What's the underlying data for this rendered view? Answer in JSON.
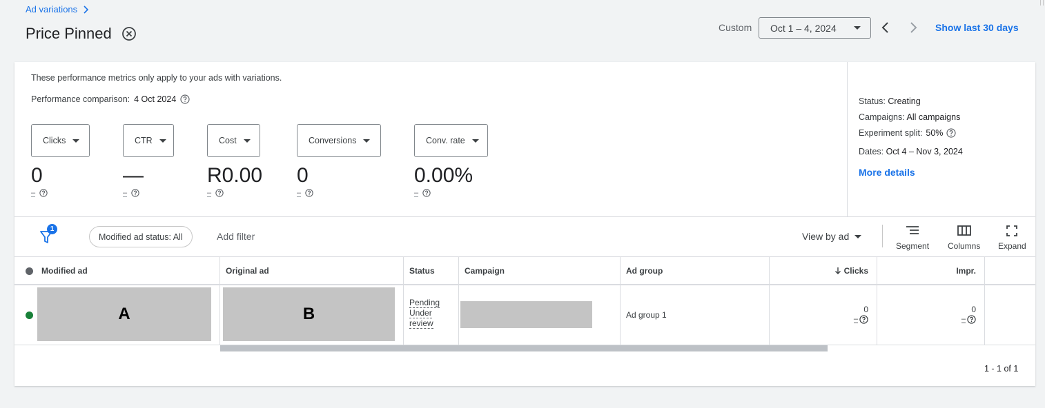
{
  "header": {
    "breadcrumb": "Ad variations",
    "title": "Price Pinned",
    "date_range_label": "Custom",
    "date_range_value": "Oct 1 – 4, 2024",
    "show_last": "Show last 30 days"
  },
  "summary": {
    "note": "These performance metrics only apply to your ads with variations.",
    "comparison_label": "Performance comparison:",
    "comparison_value": "4 Oct 2024",
    "metrics": [
      {
        "label": "Clicks",
        "value": "0",
        "sub": "–"
      },
      {
        "label": "CTR",
        "value": "—",
        "sub": "–"
      },
      {
        "label": "Cost",
        "value": "R0.00",
        "sub": "–"
      },
      {
        "label": "Conversions",
        "value": "0",
        "sub": "–"
      },
      {
        "label": "Conv. rate",
        "value": "0.00%",
        "sub": "–"
      }
    ],
    "side": {
      "status_label": "Status:",
      "status_value": "Creating",
      "campaigns_label": "Campaigns:",
      "campaigns_value": "All campaigns",
      "split_label": "Experiment split:",
      "split_value": "50%",
      "dates_label": "Dates:",
      "dates_value": "Oct 4 – Nov 3, 2024",
      "more_details": "More details"
    }
  },
  "toolbar": {
    "filter_count": "1",
    "filter_chip": "Modified ad status: All",
    "add_filter": "Add filter",
    "view_by": "View by ad",
    "segment": "Segment",
    "columns": "Columns",
    "expand": "Expand"
  },
  "table": {
    "headers": {
      "modified_ad": "Modified ad",
      "original_ad": "Original ad",
      "status": "Status",
      "campaign": "Campaign",
      "ad_group": "Ad group",
      "clicks": "Clicks",
      "impr": "Impr."
    },
    "rows": [
      {
        "modified_ad_mark": "A",
        "original_ad_mark": "B",
        "status_line1": "Pending",
        "status_line2": "Under",
        "status_line3": "review",
        "ad_group": "Ad group 1",
        "clicks": "0",
        "clicks_sub": "–",
        "impr": "0",
        "impr_sub": "–"
      }
    ],
    "pagination": "1 - 1 of 1"
  },
  "colors": {
    "accent": "#1a73e8",
    "status_enabled": "#188038",
    "header_dot": "#5f6368",
    "redaction": "#c4c4c4"
  }
}
